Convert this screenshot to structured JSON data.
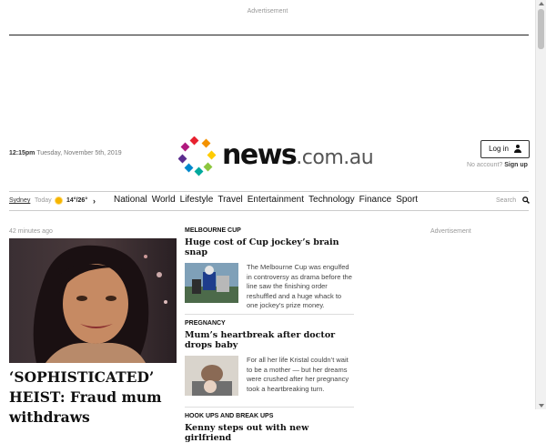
{
  "top_ad": {
    "label": "Advertisement"
  },
  "masthead": {
    "time": "12:15pm",
    "date": " Tuesday, November 5th, 2019",
    "logo_main": "news",
    "logo_domain": ".com.au",
    "login_label": "Log in",
    "no_account": "No account? ",
    "signup_label": "Sign up"
  },
  "nav": {
    "city": "Sydney",
    "today": "Today",
    "temp": "14°/26°",
    "items": [
      "National",
      "World",
      "Lifestyle",
      "Travel",
      "Entertainment",
      "Technology",
      "Finance",
      "Sport"
    ],
    "search_label": "Search"
  },
  "hero": {
    "time_ago": "42 minutes ago",
    "title": "‘SOPHISTICATED’ HEIST: Fraud mum withdraws"
  },
  "stories": [
    {
      "kicker": "MELBOURNE CUP",
      "headline": "Huge cost of Cup jockey’s brain snap",
      "summary": "The Melbourne Cup was engulfed in controversy as drama before the line saw the finishing order reshuffled and a huge whack to one jockey’s prize money."
    },
    {
      "kicker": "PREGNANCY",
      "headline": "Mum’s heartbreak after doctor drops baby",
      "summary": "For all her life Kristal couldn’t wait to be a mother — but her dreams were crushed after her pregnancy took a heartbreaking turn."
    },
    {
      "kicker": "HOOK UPS AND BREAK UPS",
      "headline": "Kenny steps out with new girlfriend"
    }
  ],
  "right_ad": {
    "label": "Advertisement"
  },
  "colors": {
    "accent": "#111111",
    "divider": "#dddddd",
    "muted": "#999999"
  },
  "icons": [
    "user-icon",
    "sun-icon",
    "chevron-right-icon",
    "search-icon"
  ]
}
